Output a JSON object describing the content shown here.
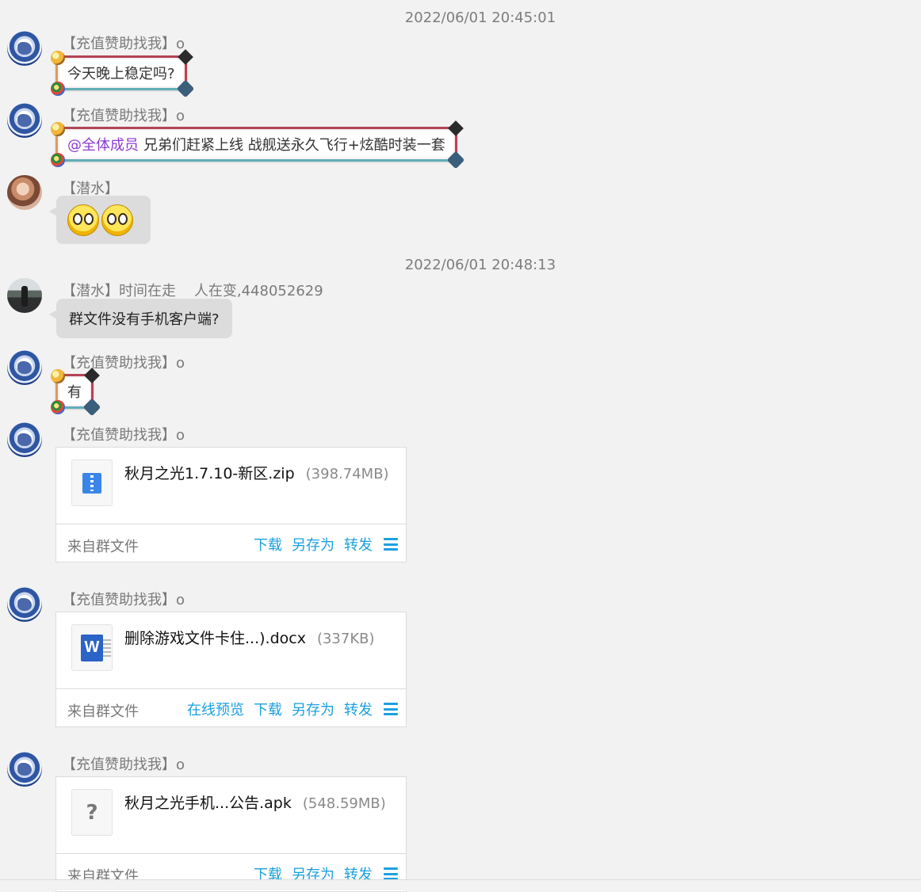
{
  "timestamps": [
    "2022/06/01 20:45:01",
    "2022/06/01 20:48:13"
  ],
  "messages": [
    {
      "sender": "【充值赞助找我】o",
      "text": "今天晚上稳定吗?"
    },
    {
      "sender": "【充值赞助找我】o",
      "mention": "@全体成员",
      "text": "兄弟们赶紧上线 战舰送永久飞行+炫酷时装一套"
    },
    {
      "sender": "【潜水】",
      "emoji": "two-emoji-faces"
    },
    {
      "sender": "【潜水】时间在走    人在变,448052629",
      "text": "群文件没有手机客户端?"
    },
    {
      "sender": "【充值赞助找我】o",
      "text": "有"
    }
  ],
  "files": [
    {
      "sender": "【充值赞助找我】o",
      "name": "秋月之光1.7.10-新区.zip",
      "size": "(398.74MB)",
      "icon": "zip-file-icon",
      "source": "来自群文件",
      "actions": [
        "下载",
        "另存为",
        "转发"
      ]
    },
    {
      "sender": "【充值赞助找我】o",
      "name": "删除游戏文件卡住...).docx",
      "size": "(337KB)",
      "icon": "word-file-icon",
      "source": "来自群文件",
      "actions": [
        "在线预览",
        "下载",
        "另存为",
        "转发"
      ]
    },
    {
      "sender": "【充值赞助找我】o",
      "name": "秋月之光手机...公告.apk",
      "size": "(548.59MB)",
      "icon": "unknown-file-icon",
      "source": "来自群文件",
      "actions": [
        "下载",
        "另存为",
        "转发"
      ]
    }
  ],
  "colors": {
    "action": "#1aa0e0",
    "mention": "#8a3bd1",
    "background": "#f2f2f2"
  }
}
